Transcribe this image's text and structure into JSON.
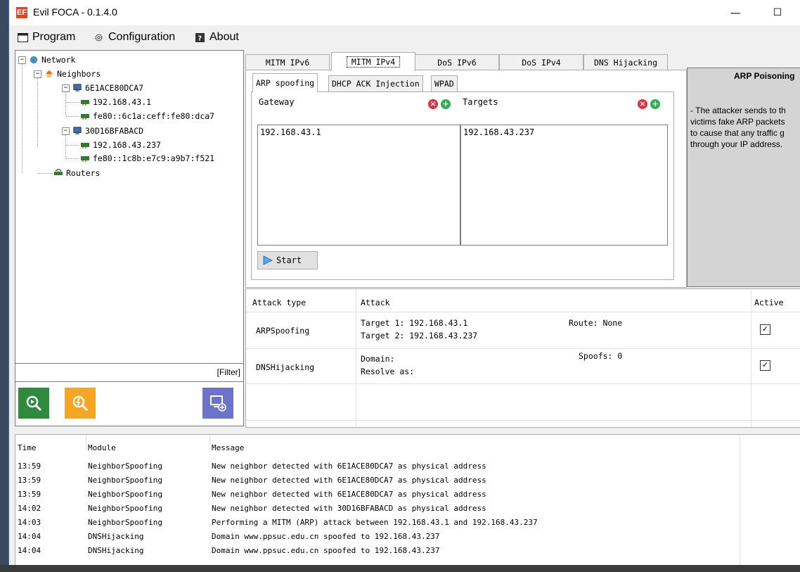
{
  "window": {
    "app_icon": "EF",
    "title": "Evil FOCA - 0.1.4.0",
    "minimize_glyph": "—",
    "maximize_glyph": "☐"
  },
  "menu": [
    {
      "label": "Program",
      "icon": "window-icon"
    },
    {
      "label": "Configuration",
      "icon": "gear-icon"
    },
    {
      "label": "About",
      "icon": "help-icon"
    }
  ],
  "tree": {
    "root": "Network",
    "neighbors_label": "Neighbors",
    "hosts": [
      {
        "name": "6E1ACE80DCA7",
        "ips": [
          "192.168.43.1",
          "fe80::6c1a:ceff:fe80:dca7"
        ]
      },
      {
        "name": "30D16BFABACD",
        "ips": [
          "192.168.43.237",
          "fe80::1c8b:e7c9:a9b7:f521"
        ]
      }
    ],
    "routers_label": "Routers"
  },
  "filter_label": "[Filter]",
  "tabs": [
    "MITM IPv6",
    "MITM IPv4",
    "DoS IPv6",
    "DoS IPv4",
    "DNS Hijacking"
  ],
  "active_tab": "MITM IPv4",
  "subtabs": [
    "ARP spoofing",
    "DHCP ACK Injection",
    "WPAD"
  ],
  "arp": {
    "gateway_label": "Gateway",
    "targets_label": "Targets",
    "gateway_items": [
      "192.168.43.1"
    ],
    "target_items": [
      "192.168.43.237"
    ],
    "start_label": "Start"
  },
  "info": {
    "title": "ARP Poisoning",
    "lines": [
      "- The attacker sends to th",
      "victims fake ARP packets",
      "to cause that any traffic g",
      "through your IP address."
    ]
  },
  "attacks": {
    "headers": {
      "type": "Attack type",
      "attack": "Attack",
      "active": "Active"
    },
    "rows": [
      {
        "type": "ARPSpoofing",
        "line1": "Target 1: 192.168.43.1",
        "line2": "Target 2: 192.168.43.237",
        "extra": "Route: None",
        "active": true
      },
      {
        "type": "DNSHijacking",
        "line1": "Domain:",
        "line2": "Resolve as:",
        "extra": "Spoofs: 0",
        "active": true
      }
    ]
  },
  "log": {
    "headers": {
      "time": "Time",
      "module": "Module",
      "message": "Message"
    },
    "rows": [
      {
        "time": "13:59",
        "module": "NeighborSpoofing",
        "message": "New neighbor detected with 6E1ACE80DCA7 as physical address"
      },
      {
        "time": "13:59",
        "module": "NeighborSpoofing",
        "message": "New neighbor detected with 6E1ACE80DCA7 as physical address"
      },
      {
        "time": "13:59",
        "module": "NeighborSpoofing",
        "message": "New neighbor detected with 6E1ACE80DCA7 as physical address"
      },
      {
        "time": "14:02",
        "module": "NeighborSpoofing",
        "message": "New neighbor detected with 30D16BFABACD as physical address"
      },
      {
        "time": "14:03",
        "module": "NeighborSpoofing",
        "message": "Performing a MITM (ARP) attack between 192.168.43.1 and 192.168.43.237"
      },
      {
        "time": "14:04",
        "module": "DNSHijacking",
        "message": "Domain www.ppsuc.edu.cn spoofed to 192.168.43.237"
      },
      {
        "time": "14:04",
        "module": "DNSHijacking",
        "message": "Domain www.ppsuc.edu.cn spoofed to 192.168.43.237"
      }
    ]
  },
  "colors": {
    "green_button": "#2e8b3e",
    "orange_button": "#f5a623",
    "purple_button": "#6c74c9",
    "remove": "#e0333a",
    "add": "#2bb24c"
  }
}
